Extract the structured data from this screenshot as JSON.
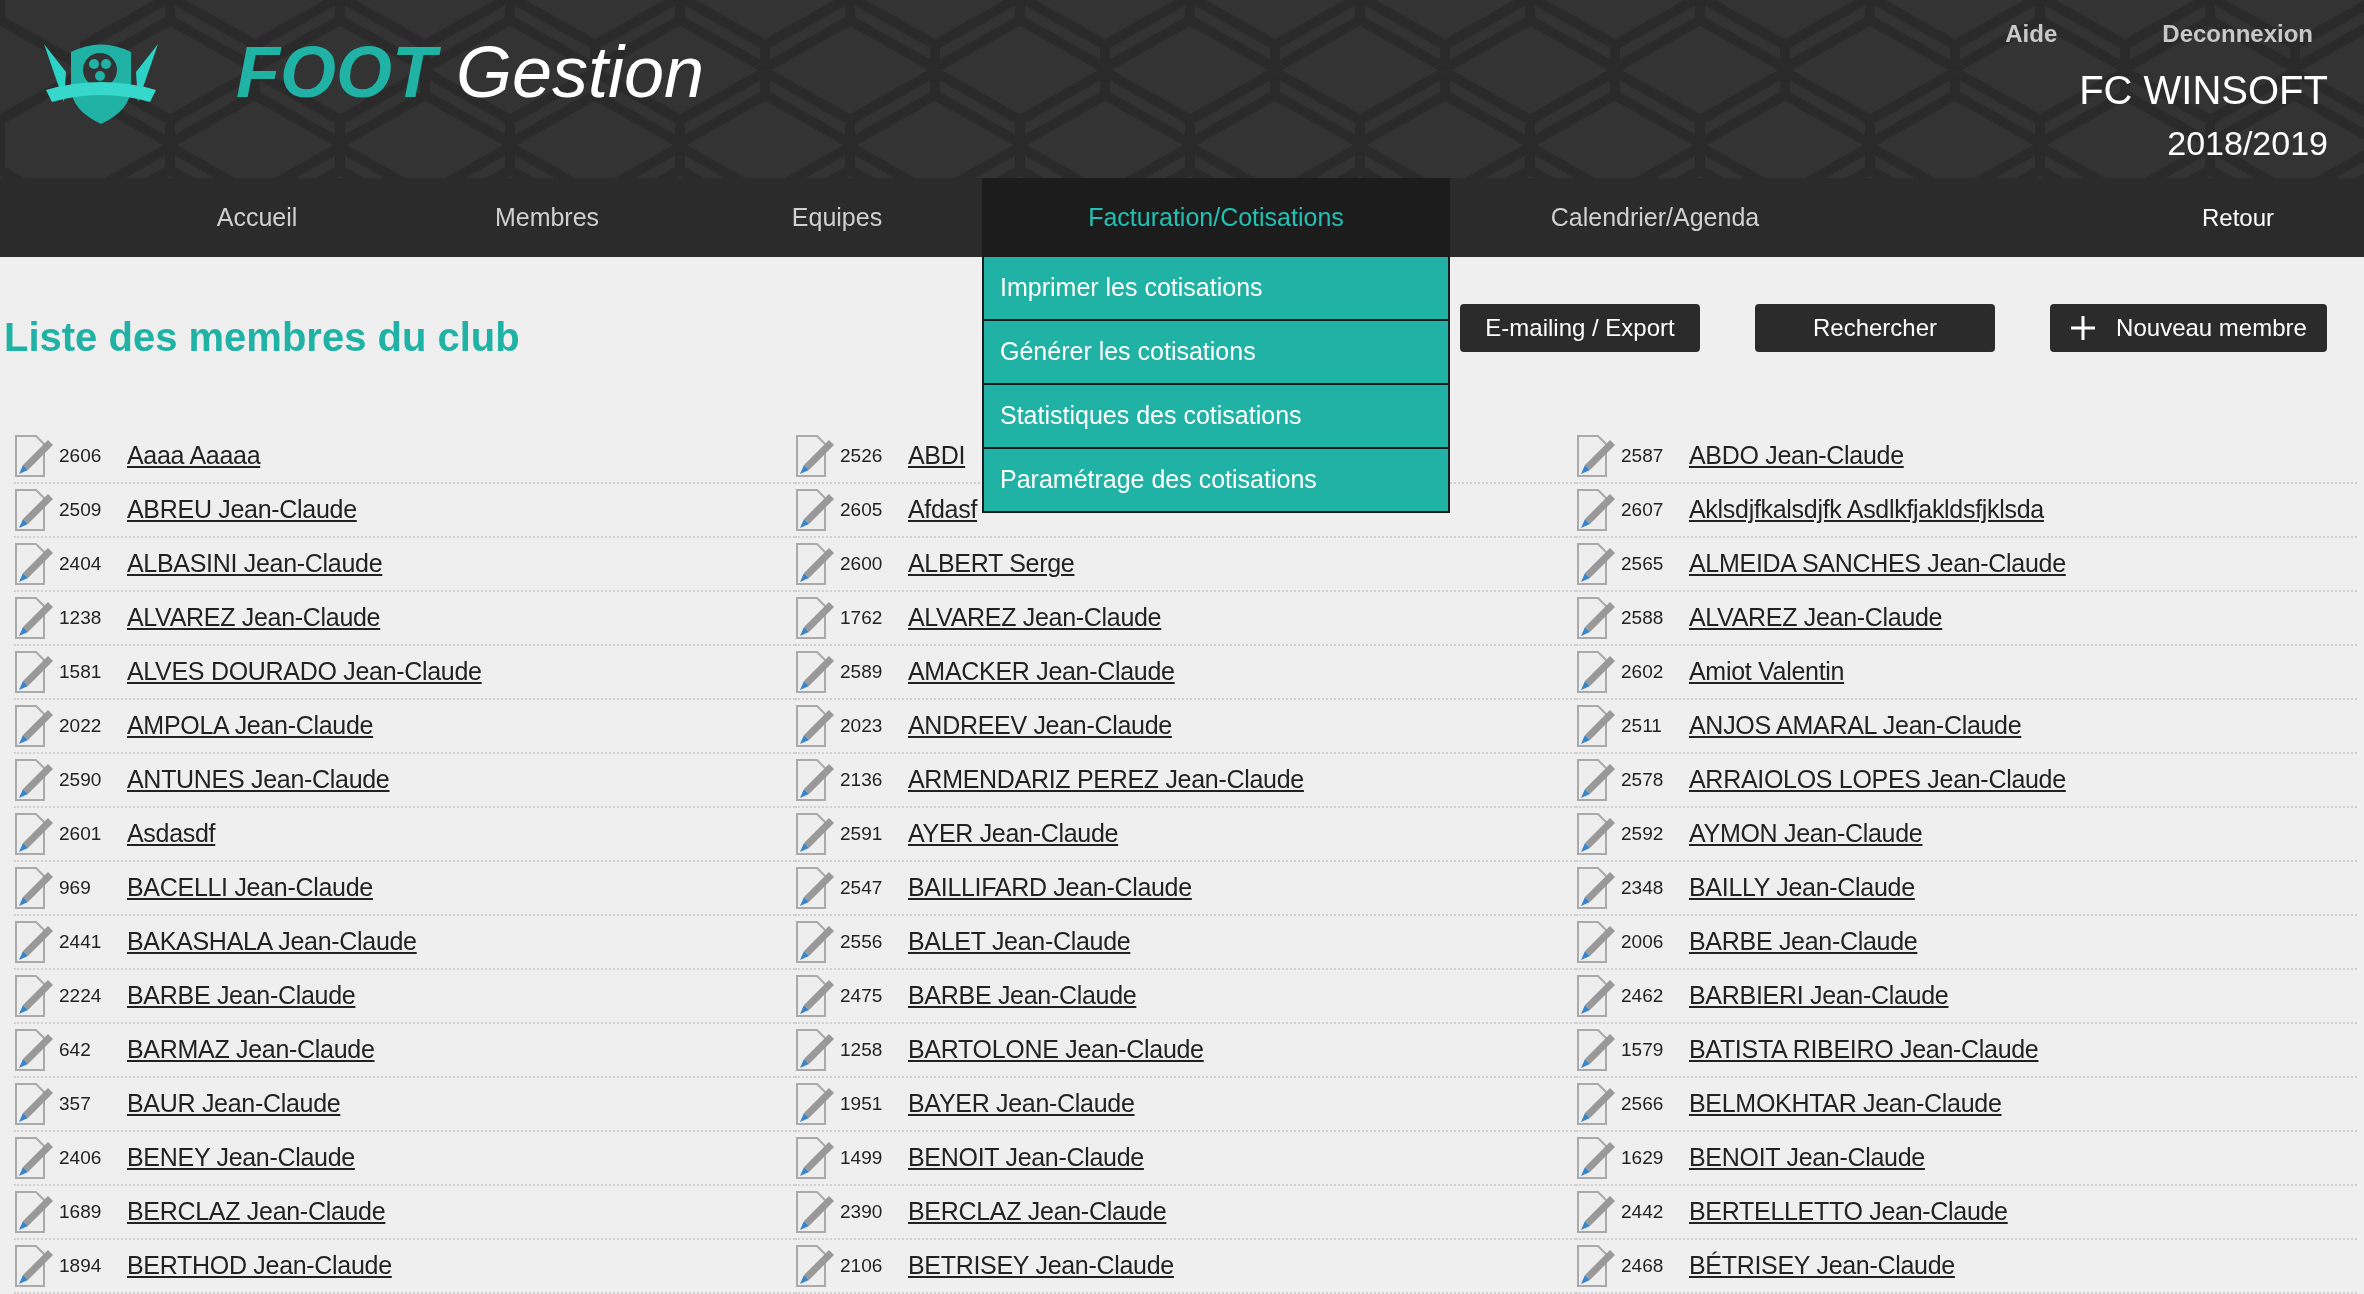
{
  "header": {
    "brand": "**FOOT** Gestion",
    "links": [
      "Aide",
      "Deconnexion"
    ],
    "club": "FC WINSOFT",
    "season": "2018/2019"
  },
  "nav": {
    "items": [
      {
        "label": "Accueil",
        "selected": false
      },
      {
        "label": "Membres",
        "selected": false
      },
      {
        "label": "Equipes",
        "selected": false
      },
      {
        "label": "Facturation/Cotisations",
        "selected": true,
        "expanded": true,
        "menu": [
          "Imprimer les cotisations",
          "Générer les cotisations",
          "Statistiques des cotisations",
          "Paramétrage des cotisations"
        ]
      },
      {
        "label": "Calendrier/Agenda",
        "selected": false
      }
    ],
    "back": "Retour"
  },
  "page_title": "Liste des membres du club",
  "actions": [
    {
      "label": "E-mailing / Export",
      "kind": "plain"
    },
    {
      "label": "Rechercher",
      "kind": "plain"
    },
    {
      "label": "Nouveau membre",
      "kind": "add"
    }
  ],
  "members": [
    {
      "id": "2606",
      "name": "Aaaa Aaaaa"
    },
    {
      "id": "2526",
      "name": "ABDI"
    },
    {
      "id": "2587",
      "name": "ABDO Jean-Claude"
    },
    {
      "id": "2509",
      "name": "ABREU Jean-Claude"
    },
    {
      "id": "2605",
      "name": "Afdasf"
    },
    {
      "id": "2607",
      "name": "Aklsdjfkalsdjfk Asdlkfjakldsfjklsda"
    },
    {
      "id": "2404",
      "name": "ALBASINI Jean-Claude"
    },
    {
      "id": "2600",
      "name": "ALBERT Serge"
    },
    {
      "id": "2565",
      "name": "ALMEIDA SANCHES Jean-Claude"
    },
    {
      "id": "1238",
      "name": "ALVAREZ Jean-Claude"
    },
    {
      "id": "1762",
      "name": "ALVAREZ Jean-Claude"
    },
    {
      "id": "2588",
      "name": "ALVAREZ Jean-Claude"
    },
    {
      "id": "1581",
      "name": "ALVES DOURADO Jean-Claude"
    },
    {
      "id": "2589",
      "name": "AMACKER Jean-Claude"
    },
    {
      "id": "2602",
      "name": "Amiot Valentin"
    },
    {
      "id": "2022",
      "name": "AMPOLA Jean-Claude"
    },
    {
      "id": "2023",
      "name": "ANDREEV Jean-Claude"
    },
    {
      "id": "2511",
      "name": "ANJOS AMARAL Jean-Claude"
    },
    {
      "id": "2590",
      "name": "ANTUNES Jean-Claude"
    },
    {
      "id": "2136",
      "name": "ARMENDARIZ PEREZ Jean-Claude"
    },
    {
      "id": "2578",
      "name": "ARRAIOLOS LOPES Jean-Claude"
    },
    {
      "id": "2601",
      "name": "Asdasdf"
    },
    {
      "id": "2591",
      "name": "AYER Jean-Claude"
    },
    {
      "id": "2592",
      "name": "AYMON Jean-Claude"
    },
    {
      "id": "969",
      "name": "BACELLI Jean-Claude"
    },
    {
      "id": "2547",
      "name": "BAILLIFARD Jean-Claude"
    },
    {
      "id": "2348",
      "name": "BAILLY Jean-Claude"
    },
    {
      "id": "2441",
      "name": "BAKASHALA Jean-Claude"
    },
    {
      "id": "2556",
      "name": "BALET Jean-Claude"
    },
    {
      "id": "2006",
      "name": "BARBE Jean-Claude"
    },
    {
      "id": "2224",
      "name": "BARBE Jean-Claude"
    },
    {
      "id": "2475",
      "name": "BARBE Jean-Claude"
    },
    {
      "id": "2462",
      "name": "BARBIERI Jean-Claude"
    },
    {
      "id": "642",
      "name": "BARMAZ Jean-Claude"
    },
    {
      "id": "1258",
      "name": "BARTOLONE Jean-Claude"
    },
    {
      "id": "1579",
      "name": "BATISTA RIBEIRO Jean-Claude"
    },
    {
      "id": "357",
      "name": "BAUR Jean-Claude"
    },
    {
      "id": "1951",
      "name": "BAYER Jean-Claude"
    },
    {
      "id": "2566",
      "name": "BELMOKHTAR Jean-Claude"
    },
    {
      "id": "2406",
      "name": "BENEY Jean-Claude"
    },
    {
      "id": "1499",
      "name": "BENOIT Jean-Claude"
    },
    {
      "id": "1629",
      "name": "BENOIT Jean-Claude"
    },
    {
      "id": "1689",
      "name": "BERCLAZ Jean-Claude"
    },
    {
      "id": "2390",
      "name": "BERCLAZ Jean-Claude"
    },
    {
      "id": "2442",
      "name": "BERTELLETTO Jean-Claude"
    },
    {
      "id": "1894",
      "name": "BERTHOD Jean-Claude"
    },
    {
      "id": "2106",
      "name": "BETRISEY Jean-Claude"
    },
    {
      "id": "2468",
      "name": "BÉTRISEY Jean-Claude"
    }
  ]
}
